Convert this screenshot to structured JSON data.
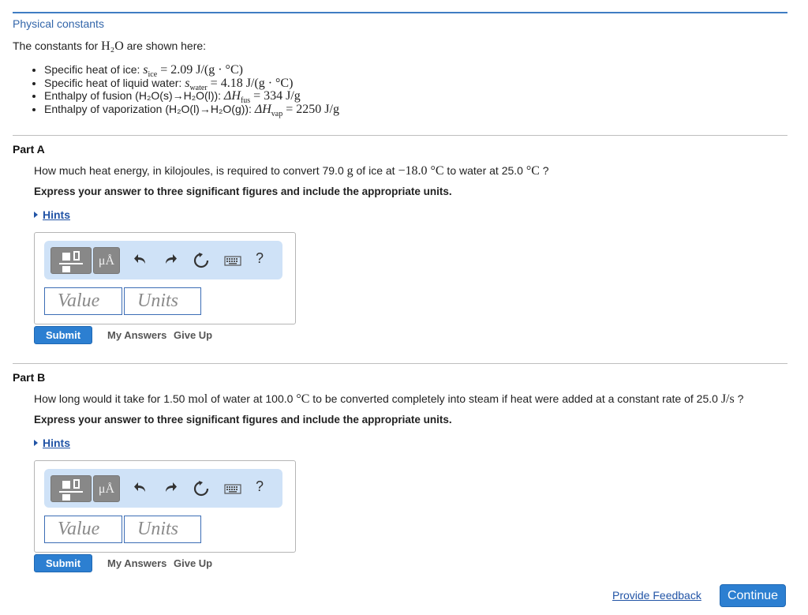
{
  "header": {
    "title": "Physical constants",
    "intro_prefix": "The constants for ",
    "intro_formula": "H₂O",
    "intro_suffix": " are shown here:"
  },
  "constants": [
    {
      "label": "Specific heat of ice: ",
      "symbol": "s",
      "sub": "ice",
      "value": " = 2.09 J/(g · °C)"
    },
    {
      "label": "Specific heat of liquid water: ",
      "symbol": "s",
      "sub": "water",
      "value": " = 4.18 J/(g · °C)"
    },
    {
      "label": "Enthalpy of fusion (H₂O(s)→H₂O(l)): ",
      "symbol": "ΔH",
      "sub": "fus",
      "value": " = 334 J/g"
    },
    {
      "label": "Enthalpy of vaporization (H₂O(l)→H₂O(g)): ",
      "symbol": "ΔH",
      "sub": "vap",
      "value": " = 2250 J/g"
    }
  ],
  "parts": [
    {
      "title": "Part A",
      "question_a": "How much heat energy, in kilojoules, is required to convert 79.0 ",
      "question_b": "g",
      "question_c": " of ice at ",
      "question_d": "−18.0 ",
      "question_e": "°C",
      "question_f": " to water at 25.0 ",
      "question_g": "°C",
      "question_h": " ?",
      "instruction": "Express your answer to three significant figures and include the appropriate units.",
      "hints": "Hints",
      "value_placeholder": "Value",
      "units_placeholder": "Units",
      "submit": "Submit",
      "my_answers": "My Answers",
      "give_up": "Give Up"
    },
    {
      "title": "Part B",
      "question_a": "How long would it take for 1.50 ",
      "question_b": "mol",
      "question_c": " of water at 100.0 ",
      "question_d": "°C",
      "question_e": " to be converted completely into steam if heat were added at a constant rate of 25.0 ",
      "question_f": "J/s",
      "question_g": " ?",
      "instruction": "Express your answer to three significant figures and include the appropriate units.",
      "hints": "Hints",
      "value_placeholder": "Value",
      "units_placeholder": "Units",
      "submit": "Submit",
      "my_answers": "My Answers",
      "give_up": "Give Up"
    }
  ],
  "toolbar": {
    "units_label": "μÅ",
    "help": "?"
  },
  "footer": {
    "feedback": "Provide Feedback",
    "continue": "Continue"
  }
}
